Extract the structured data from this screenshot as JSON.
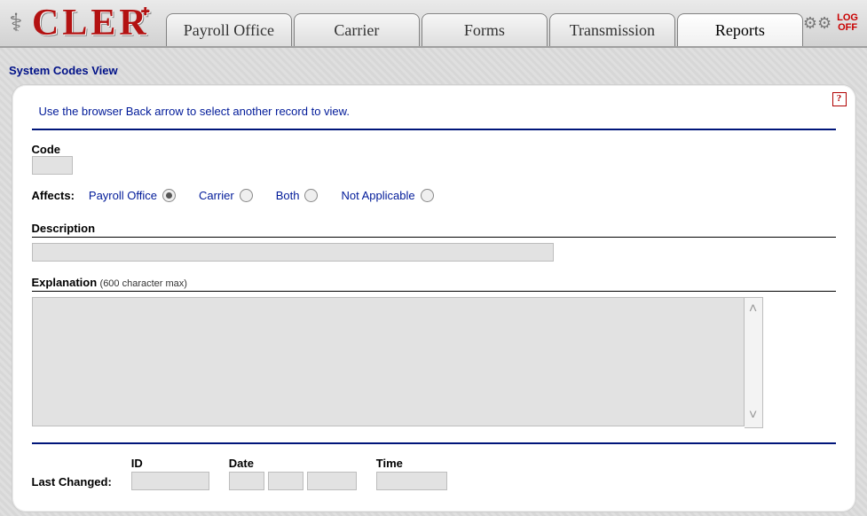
{
  "header": {
    "logo_text": "CLER",
    "tabs": [
      {
        "label": "Payroll Office",
        "active": false
      },
      {
        "label": "Carrier",
        "active": false
      },
      {
        "label": "Forms",
        "active": false
      },
      {
        "label": "Transmission",
        "active": false
      },
      {
        "label": "Reports",
        "active": true
      }
    ],
    "logoff_line1": "LOG",
    "logoff_line2": "OFF"
  },
  "page": {
    "title": "System Codes View",
    "instruction": "Use the browser Back arrow to select another record to view.",
    "help_symbol": "?"
  },
  "form": {
    "code": {
      "label": "Code",
      "value": ""
    },
    "affects": {
      "label": "Affects:",
      "options": [
        {
          "label": "Payroll Office",
          "checked": true
        },
        {
          "label": "Carrier",
          "checked": false
        },
        {
          "label": "Both",
          "checked": false
        },
        {
          "label": "Not Applicable",
          "checked": false
        }
      ]
    },
    "description": {
      "label": "Description",
      "value": ""
    },
    "explanation": {
      "label": "Explanation",
      "note": "(600 character max)",
      "value": ""
    },
    "last_changed": {
      "label": "Last Changed:",
      "id": {
        "label": "ID",
        "value": ""
      },
      "date": {
        "label": "Date",
        "value": ""
      },
      "time": {
        "label": "Time",
        "value": ""
      }
    }
  }
}
